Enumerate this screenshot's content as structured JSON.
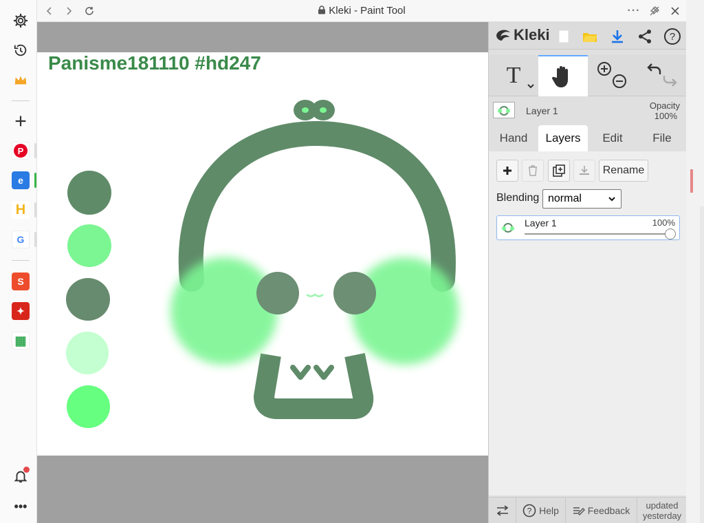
{
  "window": {
    "title": "Kleki - Paint Tool",
    "nav_back": "<",
    "nav_forward": ">",
    "more": "···"
  },
  "sidebar": {
    "items": [
      {
        "name": "settings",
        "icon": "gear-icon"
      },
      {
        "name": "history",
        "icon": "history-icon"
      },
      {
        "name": "crown",
        "icon": "crown-icon"
      },
      {
        "name": "add",
        "icon": "plus-icon"
      },
      {
        "name": "pinterest",
        "icon": "pinterest-icon",
        "glyph": "P"
      },
      {
        "name": "app-blue",
        "icon": "app-icon",
        "glyph": "e"
      },
      {
        "name": "app-h",
        "icon": "app-icon",
        "glyph": "H"
      },
      {
        "name": "google",
        "icon": "google-icon",
        "glyph": "G"
      },
      {
        "name": "shopee",
        "icon": "shopee-icon",
        "glyph": "S"
      },
      {
        "name": "game",
        "icon": "app-icon",
        "glyph": "✦"
      },
      {
        "name": "sheets",
        "icon": "sheets-icon",
        "glyph": "▦"
      }
    ],
    "notifications_icon": "bell-icon"
  },
  "canvas": {
    "title_text": "Panisme181110 #hd247",
    "swatches": [
      "#5f8b69",
      "#7cf593",
      "#678b6e",
      "#c3ffd0",
      "#66ff80"
    ]
  },
  "panel": {
    "logo": "Kleki",
    "layer_thumb_name": "Layer 1",
    "opacity_label": "Opacity",
    "opacity_value": "100%",
    "tabs": [
      "Hand",
      "Layers",
      "Edit",
      "File"
    ],
    "active_tab": "Layers",
    "rename_label": "Rename",
    "blending_label": "Blending",
    "blending_value": "normal",
    "layers": [
      {
        "name": "Layer 1",
        "opacity": "100%",
        "opacity_fraction": 1.0
      }
    ],
    "bottom": {
      "help": "Help",
      "feedback": "Feedback",
      "updated_line1": "updated",
      "updated_line2": "yesterday"
    }
  },
  "colors": {
    "accent_blue": "#62a9ff",
    "title_green": "#3a8a4a",
    "drawing_green": "#5f8b69",
    "cheek_green": "#7cf593"
  }
}
